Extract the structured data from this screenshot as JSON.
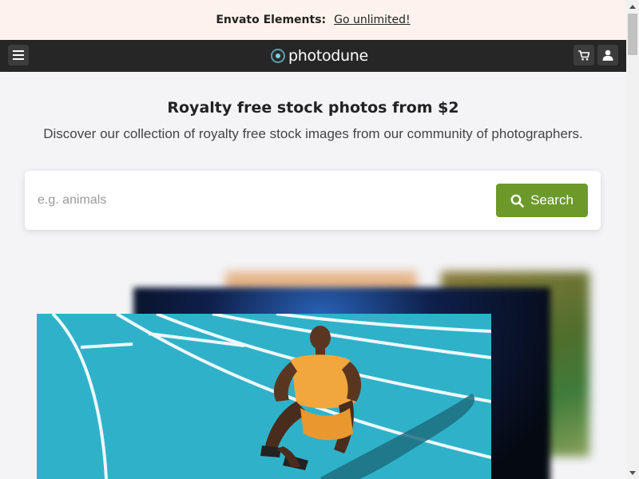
{
  "promo": {
    "brand": "Envato Elements:",
    "link": "Go unlimited!"
  },
  "nav": {
    "logo": "photodune"
  },
  "hero": {
    "title": "Royalty free stock photos from $2",
    "subtitle": "Discover our collection of royalty free stock images from our community of photographers."
  },
  "search": {
    "placeholder": "e.g. animals",
    "button": "Search"
  },
  "colors": {
    "accent_green": "#6b9a2a",
    "navbar": "#262626",
    "promo_bg": "#fdf3ec"
  },
  "icons": [
    "menu-icon",
    "cart-icon",
    "user-icon",
    "search-icon"
  ]
}
